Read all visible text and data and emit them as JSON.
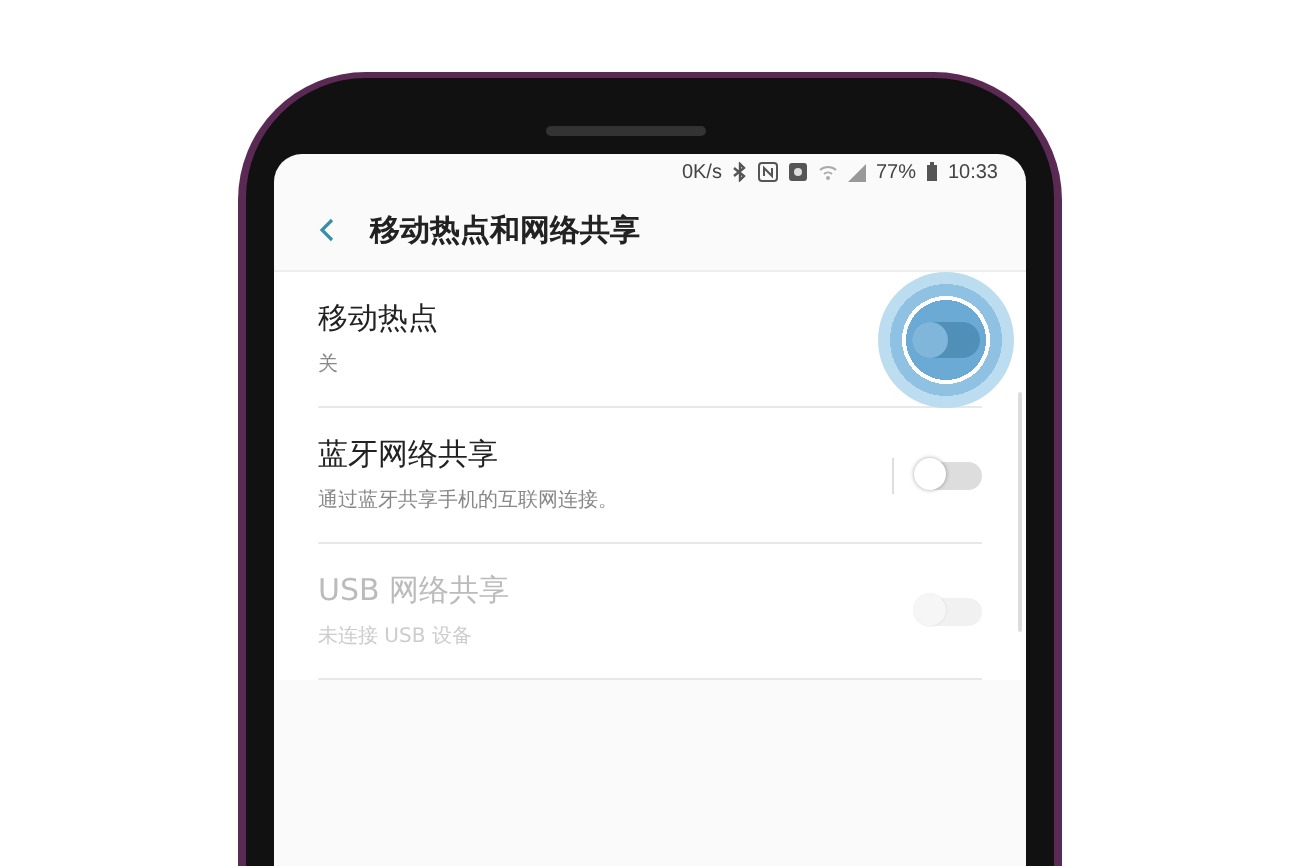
{
  "status_bar": {
    "speed": "0K/s",
    "battery": "77%",
    "time": "10:33"
  },
  "header": {
    "title": "移动热点和网络共享"
  },
  "settings": [
    {
      "title": "移动热点",
      "subtitle": "关",
      "checked": false,
      "disabled": false,
      "pressed": true,
      "divider": false
    },
    {
      "title": "蓝牙网络共享",
      "subtitle": "通过蓝牙共享手机的互联网连接。",
      "checked": false,
      "disabled": false,
      "pressed": false,
      "divider": true
    },
    {
      "title": "USB 网络共享",
      "subtitle": "未连接 USB 设备",
      "checked": false,
      "disabled": true,
      "pressed": false,
      "divider": false
    }
  ]
}
